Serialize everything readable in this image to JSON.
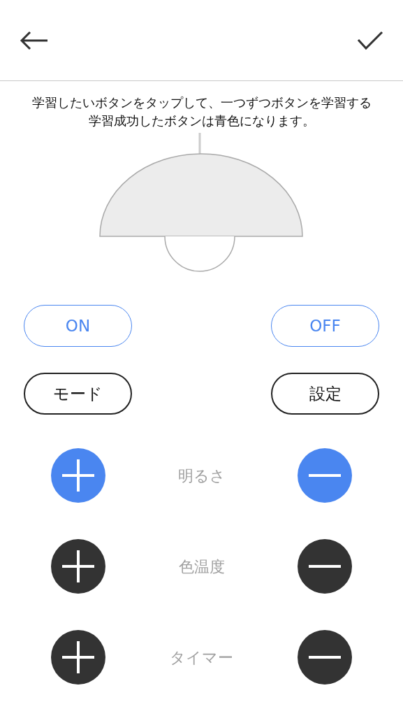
{
  "header": {
    "back": true,
    "confirm": true
  },
  "instructions": [
    "学習したいボタンをタップして、一つずつボタンを学習する",
    "学習成功したボタンは青色になります。"
  ],
  "text_buttons": [
    {
      "label": "ON",
      "learned": true
    },
    {
      "label": "OFF",
      "learned": true
    },
    {
      "label": "モード",
      "learned": false
    },
    {
      "label": "設定",
      "learned": false
    }
  ],
  "adjust_rows": [
    {
      "label": "明るさ",
      "plus_learned": true,
      "minus_learned": true
    },
    {
      "label": "色温度",
      "plus_learned": false,
      "minus_learned": false
    },
    {
      "label": "タイマー",
      "plus_learned": false,
      "minus_learned": false
    }
  ]
}
